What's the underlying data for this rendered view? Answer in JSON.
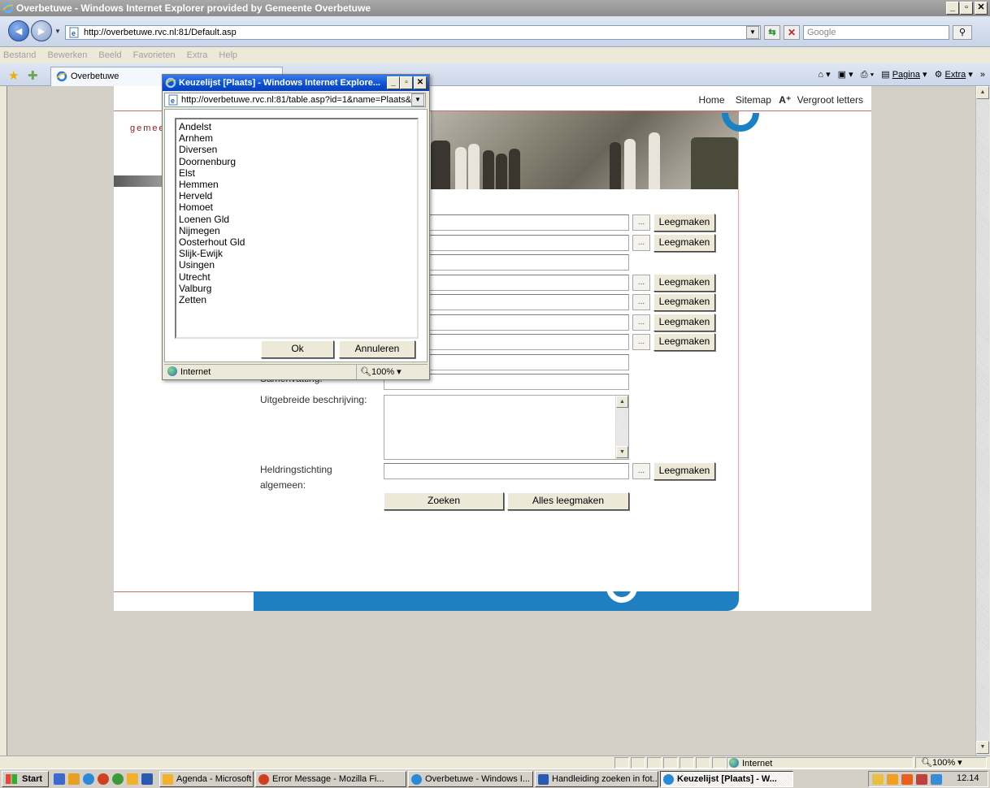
{
  "window": {
    "title": "Overbetuwe - Windows Internet Explorer provided by Gemeente Overbetuwe",
    "url": "http://overbetuwe.rvc.nl:81/Default.asp",
    "search_placeholder": "Google"
  },
  "menu": [
    "Bestand",
    "Bewerken",
    "Beeld",
    "Favorieten",
    "Extra",
    "Help"
  ],
  "tab": {
    "label": "Overbetuwe"
  },
  "commandbar": {
    "page": "Pagina",
    "extra": "Extra"
  },
  "page": {
    "nav": {
      "home": "Home",
      "sitemap": "Sitemap",
      "zoom_mark": "A⁺",
      "bigger": "Vergroot letters"
    },
    "logo_text": "gemee",
    "form": {
      "clear_label": "Leegmaken",
      "dots_label": "...",
      "summary_label": "Samenvatting:",
      "long_desc_label": "Uitgebreide beschrijving:",
      "heritage_label_1": "Heldringstichting",
      "heritage_label_2": "algemeen:",
      "search_button": "Zoeken",
      "clear_all_button": "Alles leegmaken"
    }
  },
  "popup": {
    "title": "Keuzelijst [Plaats] - Windows Internet Explore...",
    "url": "http://overbetuwe.rvc.nl:81/table.asp?id=1&name=Plaats&wl",
    "places": [
      "Andelst",
      "Arnhem",
      "Diversen",
      "Doornenburg",
      "Elst",
      "Hemmen",
      "Herveld",
      "Homoet",
      "Loenen Gld",
      "Nijmegen",
      "Oosterhout Gld",
      "Slijk-Ewijk",
      "Usingen",
      "Utrecht",
      "Valburg",
      "Zetten"
    ],
    "ok_button": "Ok",
    "cancel_button": "Annuleren",
    "status_zone": "Internet",
    "zoom": "100%"
  },
  "statusbar": {
    "zone": "Internet",
    "zoom": "100%"
  },
  "taskbar": {
    "start": "Start",
    "tasks": [
      "Agenda - Microsoft Outlo...",
      "Error Message - Mozilla Fi...",
      "Overbetuwe - Windows I...",
      "Handleiding zoeken in fot...",
      "Keuzelijst [Plaats] - W..."
    ],
    "clock": "12.14"
  },
  "colors": {
    "accent_blue": "#1f7fc0",
    "brand_red": "#8b1a1a",
    "title_active": "#0a4fd4"
  }
}
